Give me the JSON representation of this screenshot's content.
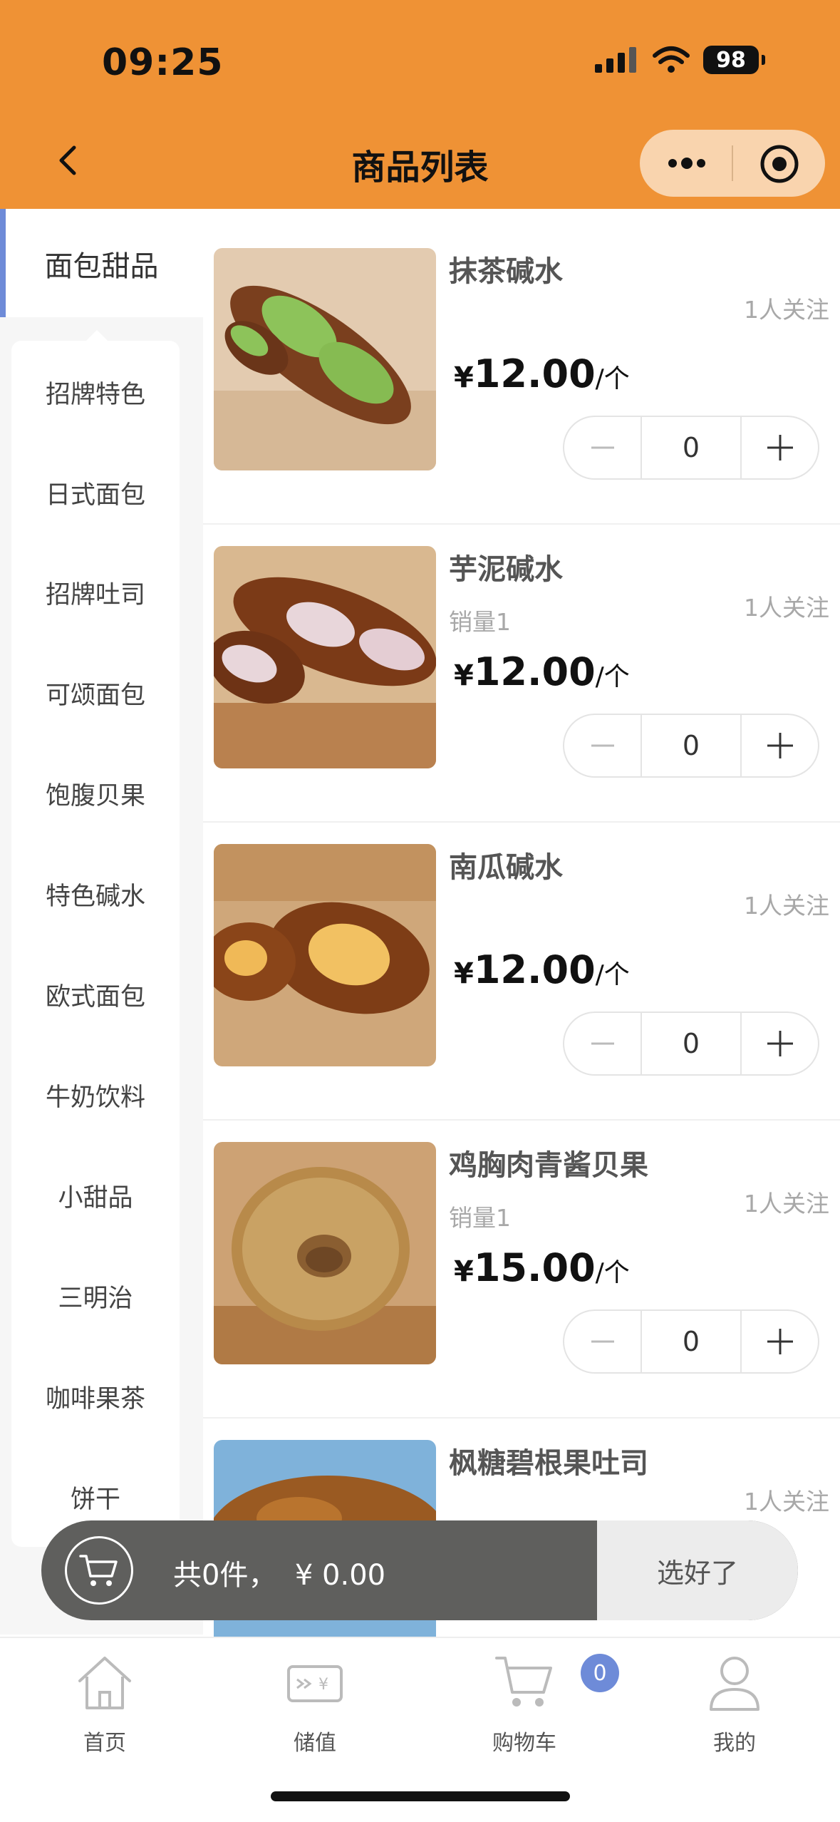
{
  "status_bar": {
    "time": "09:25",
    "battery": "98"
  },
  "nav": {
    "title": "商品列表"
  },
  "sidebar": {
    "active_label": "面包甜品",
    "items": [
      "招牌特色",
      "日式面包",
      "招牌吐司",
      "可颂面包",
      "饱腹贝果",
      "特色碱水",
      "欧式面包",
      "牛奶饮料",
      "小甜品",
      "三明治",
      "咖啡果茶",
      "饼干"
    ]
  },
  "products": [
    {
      "name": "抹茶碱水",
      "sales": "",
      "follow": "1人关注",
      "yen": "¥",
      "price": "12.00",
      "unit": "/个",
      "qty": "0"
    },
    {
      "name": "芋泥碱水",
      "sales": "销量1",
      "follow": "1人关注",
      "yen": "¥",
      "price": "12.00",
      "unit": "/个",
      "qty": "0"
    },
    {
      "name": "南瓜碱水",
      "sales": "",
      "follow": "1人关注",
      "yen": "¥",
      "price": "12.00",
      "unit": "/个",
      "qty": "0"
    },
    {
      "name": "鸡胸肉青酱贝果",
      "sales": "销量1",
      "follow": "1人关注",
      "yen": "¥",
      "price": "15.00",
      "unit": "/个",
      "qty": "0"
    },
    {
      "name": "枫糖碧根果吐司",
      "sales": "",
      "follow": "1人关注",
      "yen": "¥",
      "price": "",
      "unit": "",
      "qty": ""
    }
  ],
  "cart": {
    "summary": "共0件，  ¥ 0.00",
    "confirm_label": "选好了"
  },
  "tabbar": {
    "items": [
      {
        "label": "首页",
        "icon": "home-icon"
      },
      {
        "label": "储值",
        "icon": "stored-value-icon"
      },
      {
        "label": "购物车",
        "icon": "cart-icon"
      },
      {
        "label": "我的",
        "icon": "user-icon"
      }
    ],
    "cart_badge": "0"
  },
  "colors": {
    "header": "#EF9235",
    "accent": "#6E8BD8",
    "cart_bar": "#5f5f5d"
  }
}
